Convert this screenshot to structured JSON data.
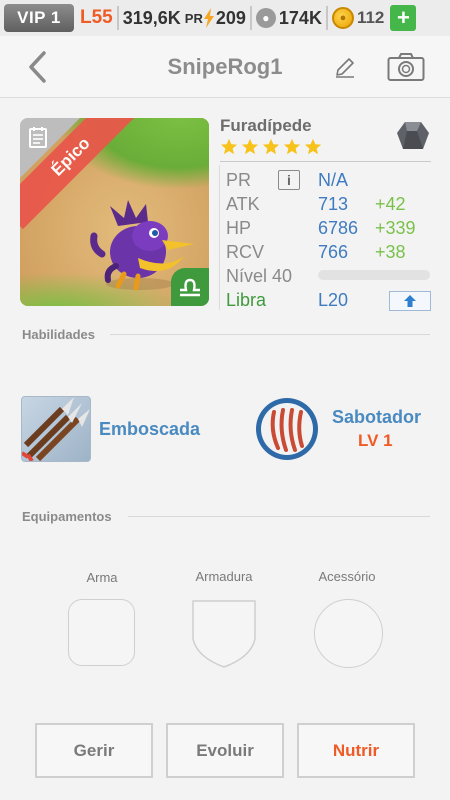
{
  "status_bar": {
    "vip": "VIP 1",
    "level": "L55",
    "power": "319,6K",
    "power_label": "PR",
    "energy": "209",
    "food": "174K",
    "gold": "112",
    "add": "+"
  },
  "header": {
    "title": "SnipeRog1"
  },
  "dragon": {
    "rarity": "Épico",
    "name": "Furadípede",
    "stars": 5,
    "stats": {
      "pr_label": "PR",
      "pr_info": "i",
      "pr_value": "N/A",
      "atk_label": "ATK",
      "atk_value": "713",
      "atk_bonus": "+42",
      "hp_label": "HP",
      "hp_value": "6786",
      "hp_bonus": "+339",
      "rcv_label": "RCV",
      "rcv_value": "766",
      "rcv_bonus": "+38",
      "level_label": "Nível 40",
      "level_progress": 0,
      "zodiac_label": "Libra",
      "zodiac_level": "L20"
    }
  },
  "skills": {
    "section_title": "Habilidades",
    "items": [
      {
        "name": "Emboscada"
      },
      {
        "name": "Sabotador",
        "level": "LV 1"
      }
    ]
  },
  "equipment": {
    "section_title": "Equipamentos",
    "slots": [
      {
        "label": "Arma"
      },
      {
        "label": "Armadura"
      },
      {
        "label": "Acessório"
      }
    ]
  },
  "actions": {
    "manage": "Gerir",
    "evolve": "Evoluir",
    "feed": "Nutrir",
    "feed_color": "#f05a24"
  }
}
